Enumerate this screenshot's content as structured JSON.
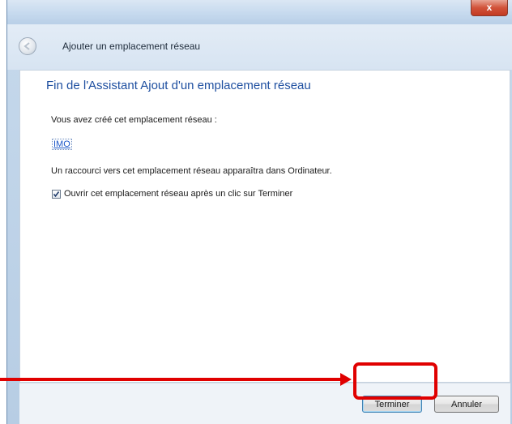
{
  "window": {
    "close_label": "x",
    "nav_title": "Ajouter un emplacement réseau"
  },
  "content": {
    "heading": "Fin de l'Assistant Ajout d'un emplacement réseau",
    "created_text": "Vous avez créé cet emplacement réseau :",
    "location_name": "IMO",
    "shortcut_text": "Un raccourci vers cet emplacement réseau apparaîtra dans Ordinateur.",
    "open_checkbox": {
      "label": "Ouvrir cet emplacement réseau après un clic sur Terminer",
      "checked": true
    }
  },
  "footer": {
    "finish_label": "Terminer",
    "cancel_label": "Annuler"
  },
  "annotation": {
    "color": "#e00000"
  }
}
